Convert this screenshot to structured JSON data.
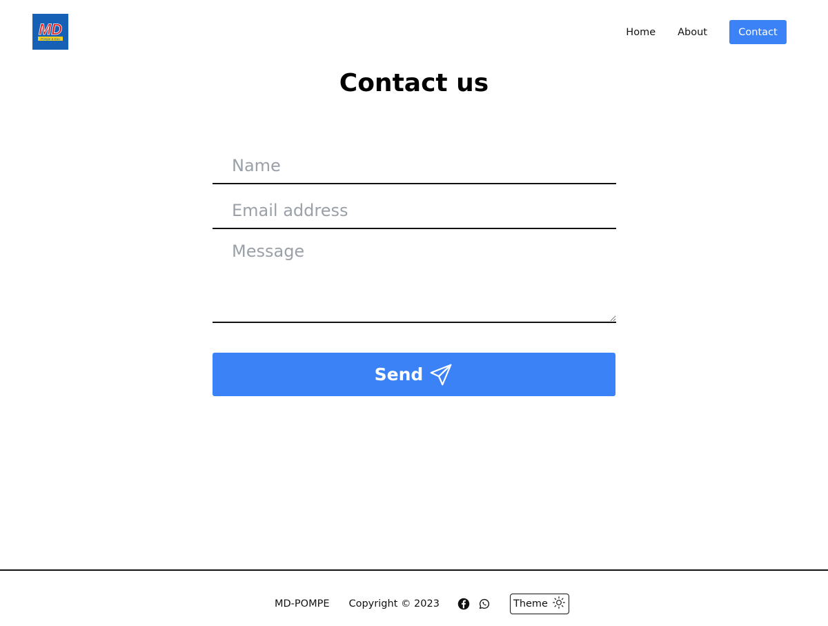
{
  "header": {
    "logo_text": "MD",
    "logo_subtext": "Pompe & Eau",
    "nav": {
      "home": "Home",
      "about": "About",
      "contact": "Contact"
    }
  },
  "main": {
    "title": "Contact us",
    "form": {
      "name_placeholder": "Name",
      "name_value": "",
      "email_placeholder": "Email address",
      "email_value": "",
      "message_placeholder": "Message",
      "message_value": "",
      "send_label": "Send"
    }
  },
  "footer": {
    "brand": "MD-POMPE",
    "copyright": "Copyright © 2023",
    "theme_label": "Theme"
  },
  "colors": {
    "accent": "#3b82f6",
    "logo_background": "#1660b5",
    "logo_red": "#e21b1b",
    "logo_yellow": "#f4d21c",
    "placeholder": "#9aa0a8"
  },
  "icons": {
    "send": "paper-plane-icon",
    "facebook": "facebook-icon",
    "whatsapp": "whatsapp-icon",
    "theme": "sun-icon"
  }
}
